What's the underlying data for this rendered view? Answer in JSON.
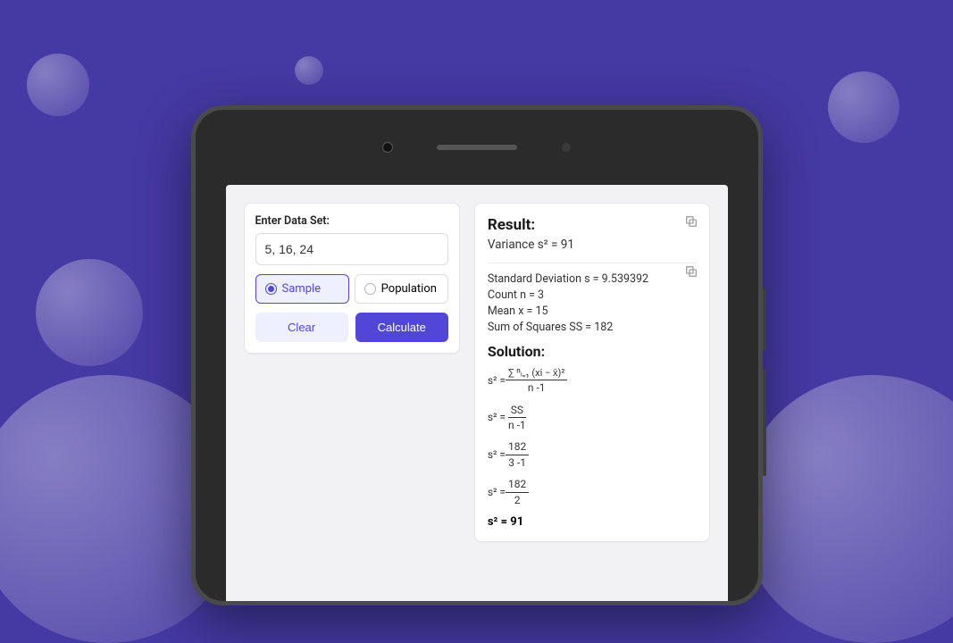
{
  "input": {
    "label": "Enter Data Set:",
    "value": "5, 16, 24"
  },
  "radios": {
    "sample": "Sample",
    "population": "Population"
  },
  "buttons": {
    "clear": "Clear",
    "calculate": "Calculate"
  },
  "result": {
    "title": "Result:",
    "variance": "Variance s² = 91",
    "std_dev": "Standard Deviation s = 9.539392",
    "count": "Count n = 3",
    "mean": "Mean x = 15",
    "ss": "Sum of Squares SS = 182",
    "solution_title": "Solution:",
    "f1_lhs": "s² = ",
    "f1_num": "∑ ⁿᵢ₌₁ (xi − x̄)²",
    "f1_den": "n -1",
    "f2_num": "SS",
    "f2_den": "n -1",
    "f3_num": "182",
    "f3_den": "3 -1",
    "f4_num": "182",
    "f4_den": "2",
    "final": "s² = 91"
  }
}
